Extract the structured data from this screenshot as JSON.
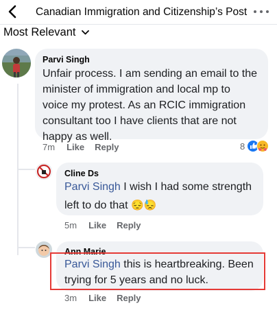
{
  "header": {
    "title": "Canadian Immigration and Citizenship’s Post"
  },
  "sort": {
    "label": "Most Relevant"
  },
  "comments": [
    {
      "author": "Parvi Singh",
      "text": [
        "Unfair process. I am sending an email to the",
        "minister of immigration and local mp to",
        "voice my protest. As an RCIC immigration",
        "consultant too I have clients that are not",
        "happy as well."
      ],
      "time": "7m",
      "like": "Like",
      "reply": "Reply",
      "reaction_count": "8",
      "reaction_icons": [
        "like-icon",
        "care-icon"
      ]
    },
    {
      "author": "Cline Ds",
      "mention": "Parvi Singh",
      "text_line1": " I wish I had some strength",
      "text_line2": "left to do that",
      "emojis": "😔😓",
      "time": "5m",
      "like": "Like",
      "reply": "Reply"
    },
    {
      "author": "Ann Marie",
      "mention": "Parvi Singh",
      "text_line1": " this is heartbreaking. Been",
      "text_line2": "trying for 5 years and no luck.",
      "time": "3m",
      "like": "Like",
      "reply": "Reply"
    }
  ],
  "colors": {
    "mention": "#385898",
    "highlight": "#e53935",
    "bubble": "#f0f2f5",
    "meta": "#65676b"
  }
}
